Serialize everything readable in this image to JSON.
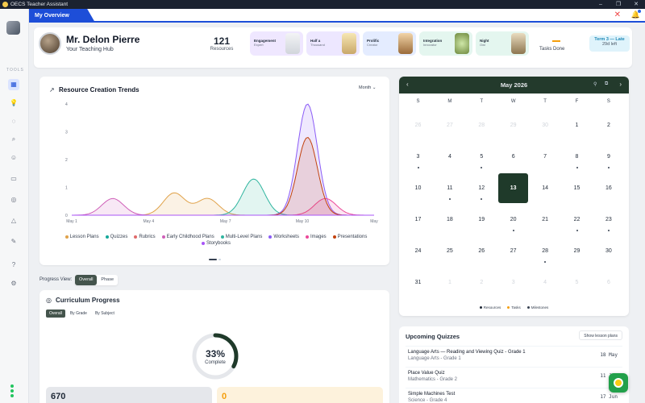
{
  "window": {
    "title": "OECS Teacher Assistant"
  },
  "tabs": [
    {
      "label": "My Overview"
    }
  ],
  "sidebar": {
    "section_label": "TOOLS"
  },
  "profile": {
    "name": "Mr. Delon Pierre",
    "subtitle": "Your Teaching Hub",
    "resource_count": "121",
    "resource_label": "Resources",
    "badges": [
      {
        "title": "Engagement",
        "sub": "Expert",
        "bg": "#efe7ff"
      },
      {
        "title": "Half a",
        "sub": "Thousand",
        "bg": "#ede7ff"
      },
      {
        "title": "Prolific",
        "sub": "Creator",
        "bg": "#e4ecff"
      },
      {
        "title": "Integration",
        "sub": "Innovator",
        "bg": "#e4f6ef"
      },
      {
        "title": "Night",
        "sub": "Owl",
        "bg": "#e4f6ef"
      }
    ],
    "tasks_label": "Tasks Done",
    "term_label": "Term 3 — Late",
    "term_left": "29d left"
  },
  "chart": {
    "title": "Resource Creation Trends",
    "range_select": "Month"
  },
  "chart_data": {
    "type": "area",
    "title": "Resource Creation Trends",
    "x_ticks": [
      "May 1",
      "May 4",
      "May 7",
      "May 10",
      "May"
    ],
    "y_ticks": [
      "0",
      "1",
      "2",
      "3",
      "4"
    ],
    "ylim": [
      0,
      4
    ],
    "series": [
      {
        "name": "Lesson Plans",
        "color": "#e0a24a",
        "x": [
          5.0,
          6.3
        ],
        "values": [
          0.8,
          0.6
        ]
      },
      {
        "name": "Quizzes",
        "color": "#15a89a",
        "x": [
          5.5
        ],
        "values": [
          0
        ]
      },
      {
        "name": "Rubrics",
        "color": "#e06a6a",
        "x": [
          9.1
        ],
        "values": [
          0
        ]
      },
      {
        "name": "Early Childhood Plans",
        "color": "#cf5fb8",
        "x": [
          2.6,
          9.2
        ],
        "values": [
          0.6,
          0
        ]
      },
      {
        "name": "Multi-Level Plans",
        "color": "#2fb59f",
        "x": [
          8.1
        ],
        "values": [
          1.3
        ]
      },
      {
        "name": "Worksheets",
        "color": "#8b5cf6",
        "x": [
          10.2
        ],
        "values": [
          4.0
        ]
      },
      {
        "name": "Images",
        "color": "#ec4899",
        "x": [
          10.9
        ],
        "values": [
          0.6
        ]
      },
      {
        "name": "Presentations",
        "color": "#c2410c",
        "x": [
          10.2
        ],
        "values": [
          2.8
        ]
      },
      {
        "name": "Storybooks",
        "color": "#a855f7",
        "x": [
          4.6
        ],
        "values": [
          0
        ]
      }
    ],
    "legend": [
      "Lesson Plans",
      "Quizzes",
      "Rubrics",
      "Early Childhood Plans",
      "Multi-Level Plans",
      "Worksheets",
      "Images",
      "Presentations",
      "Storybooks"
    ]
  },
  "progress_view": {
    "label": "Progress View:",
    "options": [
      "Overall",
      "Phase"
    ],
    "selected": "Overall"
  },
  "curriculum": {
    "title": "Curriculum Progress",
    "tabs": [
      "Overall",
      "By Grade",
      "By Subject"
    ],
    "percent": "33%",
    "percent_value": 33,
    "percent_label": "Complete",
    "stat_a": "670",
    "stat_b": "0"
  },
  "calendar": {
    "title": "May 2026",
    "weekdays": [
      "S",
      "M",
      "T",
      "W",
      "T",
      "F",
      "S"
    ],
    "days": [
      {
        "d": "26",
        "m": true
      },
      {
        "d": "27",
        "m": true
      },
      {
        "d": "28",
        "m": true
      },
      {
        "d": "29",
        "m": true
      },
      {
        "d": "30",
        "m": true
      },
      {
        "d": "1"
      },
      {
        "d": "2"
      },
      {
        "d": "3",
        "dot": true
      },
      {
        "d": "4"
      },
      {
        "d": "5",
        "dot": true
      },
      {
        "d": "6"
      },
      {
        "d": "7"
      },
      {
        "d": "8",
        "dot": true
      },
      {
        "d": "9",
        "dot": true
      },
      {
        "d": "10"
      },
      {
        "d": "11",
        "dot": true
      },
      {
        "d": "12",
        "dot": true
      },
      {
        "d": "13",
        "today": true
      },
      {
        "d": "14"
      },
      {
        "d": "15"
      },
      {
        "d": "16"
      },
      {
        "d": "17"
      },
      {
        "d": "18"
      },
      {
        "d": "19"
      },
      {
        "d": "20",
        "dot": true
      },
      {
        "d": "21"
      },
      {
        "d": "22",
        "dot": true
      },
      {
        "d": "23",
        "dot": true
      },
      {
        "d": "24"
      },
      {
        "d": "25"
      },
      {
        "d": "26"
      },
      {
        "d": "27"
      },
      {
        "d": "28",
        "dot": true
      },
      {
        "d": "29"
      },
      {
        "d": "30"
      },
      {
        "d": "31"
      },
      {
        "d": "1",
        "m": true
      },
      {
        "d": "2",
        "m": true
      },
      {
        "d": "3",
        "m": true
      },
      {
        "d": "4",
        "m": true
      },
      {
        "d": "5",
        "m": true
      },
      {
        "d": "6",
        "m": true
      }
    ],
    "legend": [
      {
        "label": "Resources",
        "color": "#1f2937"
      },
      {
        "label": "Tasks",
        "color": "#f59e0b"
      },
      {
        "label": "Milestones",
        "color": "#374151"
      }
    ]
  },
  "quizzes": {
    "title": "Upcoming Quizzes",
    "action_label": "Show lesson plans",
    "items": [
      {
        "title": "Language Arts — Reading and Viewing Quiz - Grade 1",
        "subject": "Language Arts - Grade 1",
        "date": "18 May"
      },
      {
        "title": "Place Value Quiz",
        "subject": "Mathematics - Grade 2",
        "date": "11 Jun"
      },
      {
        "title": "Simple Machines Test",
        "subject": "Science - Grade 4",
        "date": "17 Jun"
      }
    ]
  }
}
